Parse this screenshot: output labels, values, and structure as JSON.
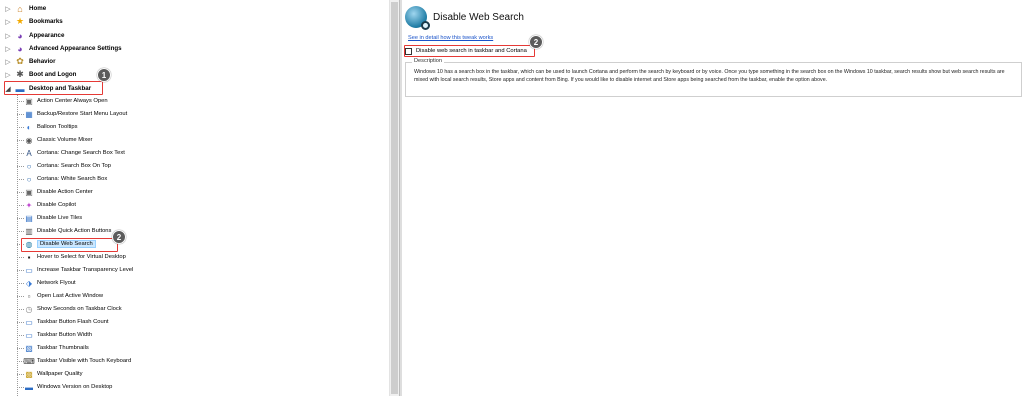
{
  "tree": {
    "top_items": [
      {
        "label": "Home",
        "icon": "home-icon",
        "expander": "▷",
        "open": false
      },
      {
        "label": "Bookmarks",
        "icon": "star-icon",
        "expander": "▷",
        "open": false
      },
      {
        "label": "Appearance",
        "icon": "palette-icon",
        "expander": "▷",
        "open": false
      },
      {
        "label": "Advanced Appearance Settings",
        "icon": "palette-icon",
        "expander": "▷",
        "open": false
      },
      {
        "label": "Behavior",
        "icon": "gear-icon",
        "expander": "▷",
        "open": false
      },
      {
        "label": "Boot and Logon",
        "icon": "spinner-icon",
        "expander": "▷",
        "open": false
      },
      {
        "label": "Desktop and Taskbar",
        "icon": "monitor-icon",
        "expander": "◢",
        "open": true
      }
    ],
    "children": [
      {
        "label": "Action Center Always Open",
        "icon": "action-center-icon"
      },
      {
        "label": "Backup/Restore Start Menu Layout",
        "icon": "start-menu-icon"
      },
      {
        "label": "Balloon Tooltips",
        "icon": "balloon-icon"
      },
      {
        "label": "Classic Volume Mixer",
        "icon": "volume-icon"
      },
      {
        "label": "Cortana: Change Search Box Text",
        "icon": "text-icon"
      },
      {
        "label": "Cortana: Search Box On Top",
        "icon": "cortana-ring-icon"
      },
      {
        "label": "Cortana: White Search Box",
        "icon": "cortana-ring-icon"
      },
      {
        "label": "Disable Action Center",
        "icon": "action-center-icon"
      },
      {
        "label": "Disable Copilot",
        "icon": "copilot-icon"
      },
      {
        "label": "Disable Live Tiles",
        "icon": "tiles-icon"
      },
      {
        "label": "Disable Quick Action Buttons",
        "icon": "quick-action-icon"
      },
      {
        "label": "Disable Web Search",
        "icon": "web-search-globe-icon",
        "selected": true
      },
      {
        "label": "Hover to Select for Virtual Desktop",
        "icon": "virtual-desktop-icon"
      },
      {
        "label": "Increase Taskbar Transparency Level",
        "icon": "taskbar-icon"
      },
      {
        "label": "Network Flyout",
        "icon": "network-icon"
      },
      {
        "label": "Open Last Active Window",
        "icon": "window-icon"
      },
      {
        "label": "Show Seconds on Taskbar Clock",
        "icon": "clock-icon"
      },
      {
        "label": "Taskbar Button Flash Count",
        "icon": "taskbar-icon"
      },
      {
        "label": "Taskbar Button Width",
        "icon": "taskbar-icon"
      },
      {
        "label": "Taskbar Thumbnails",
        "icon": "thumbnails-icon"
      },
      {
        "label": "Taskbar Visible with Touch Keyboard",
        "icon": "keyboard-icon"
      },
      {
        "label": "Wallpaper Quality",
        "icon": "wallpaper-icon"
      },
      {
        "label": "Windows Version on Desktop",
        "icon": "monitor-icon"
      }
    ]
  },
  "callouts": {
    "badge_1": "1",
    "badge_2_tree": "2",
    "badge_2_option": "2"
  },
  "panel": {
    "title": "Disable Web Search",
    "detail_link": "See in detail how this tweak works",
    "option_label": "Disable web search in taskbar and Cortana",
    "option_checked": false,
    "description_legend": "Description",
    "description_text": "Windows 10 has a search box in the taskbar, which can be used to launch Cortana and perform the search by keyboard or by voice. Once you type something in the search box on the Windows 10 taskbar, search results show but web search results are mixed with local search results, Store apps and content from Bing. If you would like to disable internet and Store apps being searched from the taskbar, enable the option above."
  },
  "colors": {
    "highlight_red": "#e53935",
    "selection_bg": "#cce8ff",
    "link_blue": "#1a53c9",
    "badge_gray": "#5c5c5c"
  }
}
